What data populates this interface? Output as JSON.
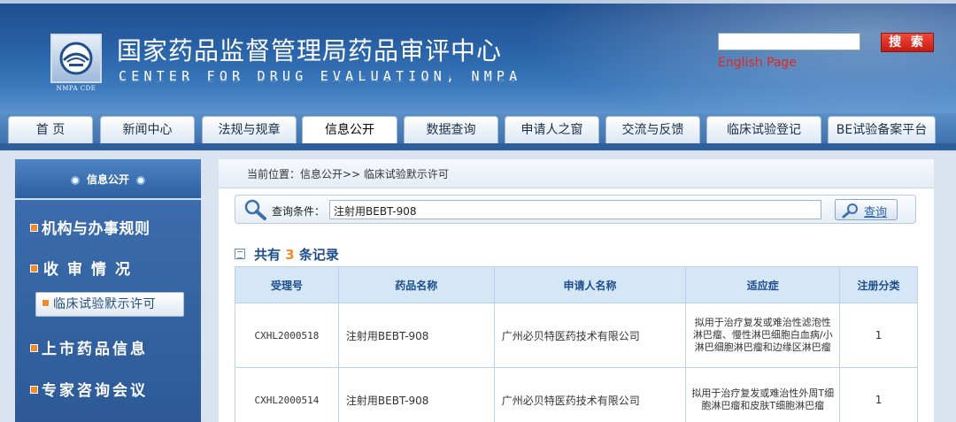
{
  "header": {
    "title_cn": "国家药品监督管理局药品审评中心",
    "title_en": "CENTER FOR DRUG EVALUATION, NMPA",
    "logo_caption": "NMPA CDE",
    "search_placeholder": "",
    "search_button": "搜 索",
    "english_link": "English Page"
  },
  "nav": {
    "items": [
      "首 页",
      "新闻中心",
      "法规与规章",
      "信息公开",
      "数据查询",
      "申请人之窗",
      "交流与反馈",
      "临床试验登记",
      "BE试验备案平台"
    ],
    "active_index": 3
  },
  "sidebar": {
    "header": "信息公开",
    "items": [
      "机构与办事规则",
      "收审情况",
      "临床试验默示许可",
      "上市药品信息",
      "专家咨询会议"
    ]
  },
  "breadcrumb": "当前位置：信息公开>> 临床试验默示许可",
  "query": {
    "label": "查询条件：",
    "value": "注射用BEBT-908",
    "button": "查询"
  },
  "total": {
    "prefix": "共有",
    "count": "3",
    "suffix": "条记录"
  },
  "table": {
    "headers": [
      "受理号",
      "药品名称",
      "申请人名称",
      "适应症",
      "注册分类"
    ],
    "rows": [
      {
        "id": "CXHL2000518",
        "drug": "注射用BEBT-908",
        "applicant": "广州必贝特医药技术有限公司",
        "indication": "拟用于治疗复发或难治性滤泡性淋巴瘤、慢性淋巴细胞白血病/小淋巴细胞淋巴瘤和边缘区淋巴瘤",
        "category": "1"
      },
      {
        "id": "CXHL2000514",
        "drug": "注射用BEBT-908",
        "applicant": "广州必贝特医药技术有限公司",
        "indication": "拟用于治疗复发或难治性外周T细胞淋巴瘤和皮肤T细胞淋巴瘤",
        "category": "1"
      }
    ]
  }
}
